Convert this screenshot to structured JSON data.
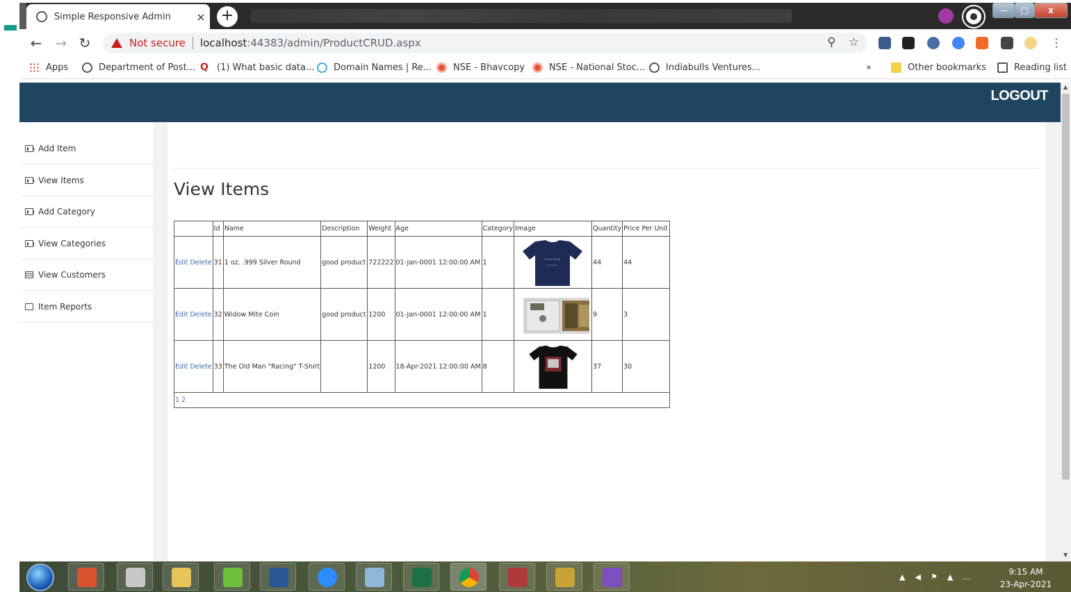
{
  "browser": {
    "tab_title": "Simple Responsive Admin",
    "tab_close": "×",
    "new_tab": "+",
    "security_label": "Not secure",
    "url_host": "localhost",
    "url_path": ":44383/admin/ProductCRUD.aspx",
    "window_controls": {
      "close": "x"
    }
  },
  "bookmarks": {
    "items": [
      {
        "label": "Apps",
        "icon": "apps-grid-icon"
      },
      {
        "label": "Department of Post...",
        "icon": "globe-icon"
      },
      {
        "label": "(1) What basic data...",
        "icon": "quora-icon"
      },
      {
        "label": "Domain Names | Re...",
        "icon": "domain-icon"
      },
      {
        "label": "NSE - Bhavcopy",
        "icon": "nse-icon"
      },
      {
        "label": "NSE - National Stoc...",
        "icon": "nse-icon"
      },
      {
        "label": "Indiabulls Ventures...",
        "icon": "globe-icon"
      }
    ],
    "overflow": "»",
    "other": "Other bookmarks",
    "reading_list": "Reading list"
  },
  "header": {
    "logout": "LOGOUT"
  },
  "sidebar": {
    "items": [
      {
        "label": "Add Item",
        "icon": "bar-chart-icon"
      },
      {
        "label": "View Items",
        "icon": "bar-chart-icon"
      },
      {
        "label": "Add Category",
        "icon": "bar-chart-icon"
      },
      {
        "label": "View Categories",
        "icon": "bar-chart-icon"
      },
      {
        "label": "View Customers",
        "icon": "table-icon"
      },
      {
        "label": "Item Reports",
        "icon": "edit-icon"
      }
    ]
  },
  "main": {
    "title": "View Items",
    "grid": {
      "headers": [
        "",
        "Id",
        "Name",
        "Description",
        "Weight",
        "Age",
        "Category",
        "Image",
        "Quantity",
        "Price Per Unit"
      ],
      "edit_label": "Edit",
      "delete_label": "Delete",
      "rows": [
        {
          "id": "31",
          "name": "1 oz. .999 Silver Round",
          "description": "good product",
          "weight": "722222",
          "age": "01-Jan-0001 12:00:00 AM",
          "category": "1",
          "image": "navy-tshirt",
          "quantity": "44",
          "price": "44"
        },
        {
          "id": "32",
          "name": "Widow Mite Coin",
          "description": "good product",
          "weight": "1200",
          "age": "01-Jan-0001 12:00:00 AM",
          "category": "1",
          "image": "coin-display",
          "quantity": "9",
          "price": "3"
        },
        {
          "id": "33",
          "name": "The Old Man \"Racing\" T-Shirt",
          "description": "",
          "weight": "1200",
          "age": "18-Apr-2021 12:00:00 AM",
          "category": "8",
          "image": "black-tshirt",
          "quantity": "37",
          "price": "30"
        }
      ],
      "pager": "1 2"
    }
  },
  "taskbar": {
    "time": "9:15 AM",
    "date": "23-Apr-2021"
  },
  "colors": {
    "topnav": "#1f4560",
    "link": "#3a6eb0",
    "warning": "#c5221f"
  }
}
